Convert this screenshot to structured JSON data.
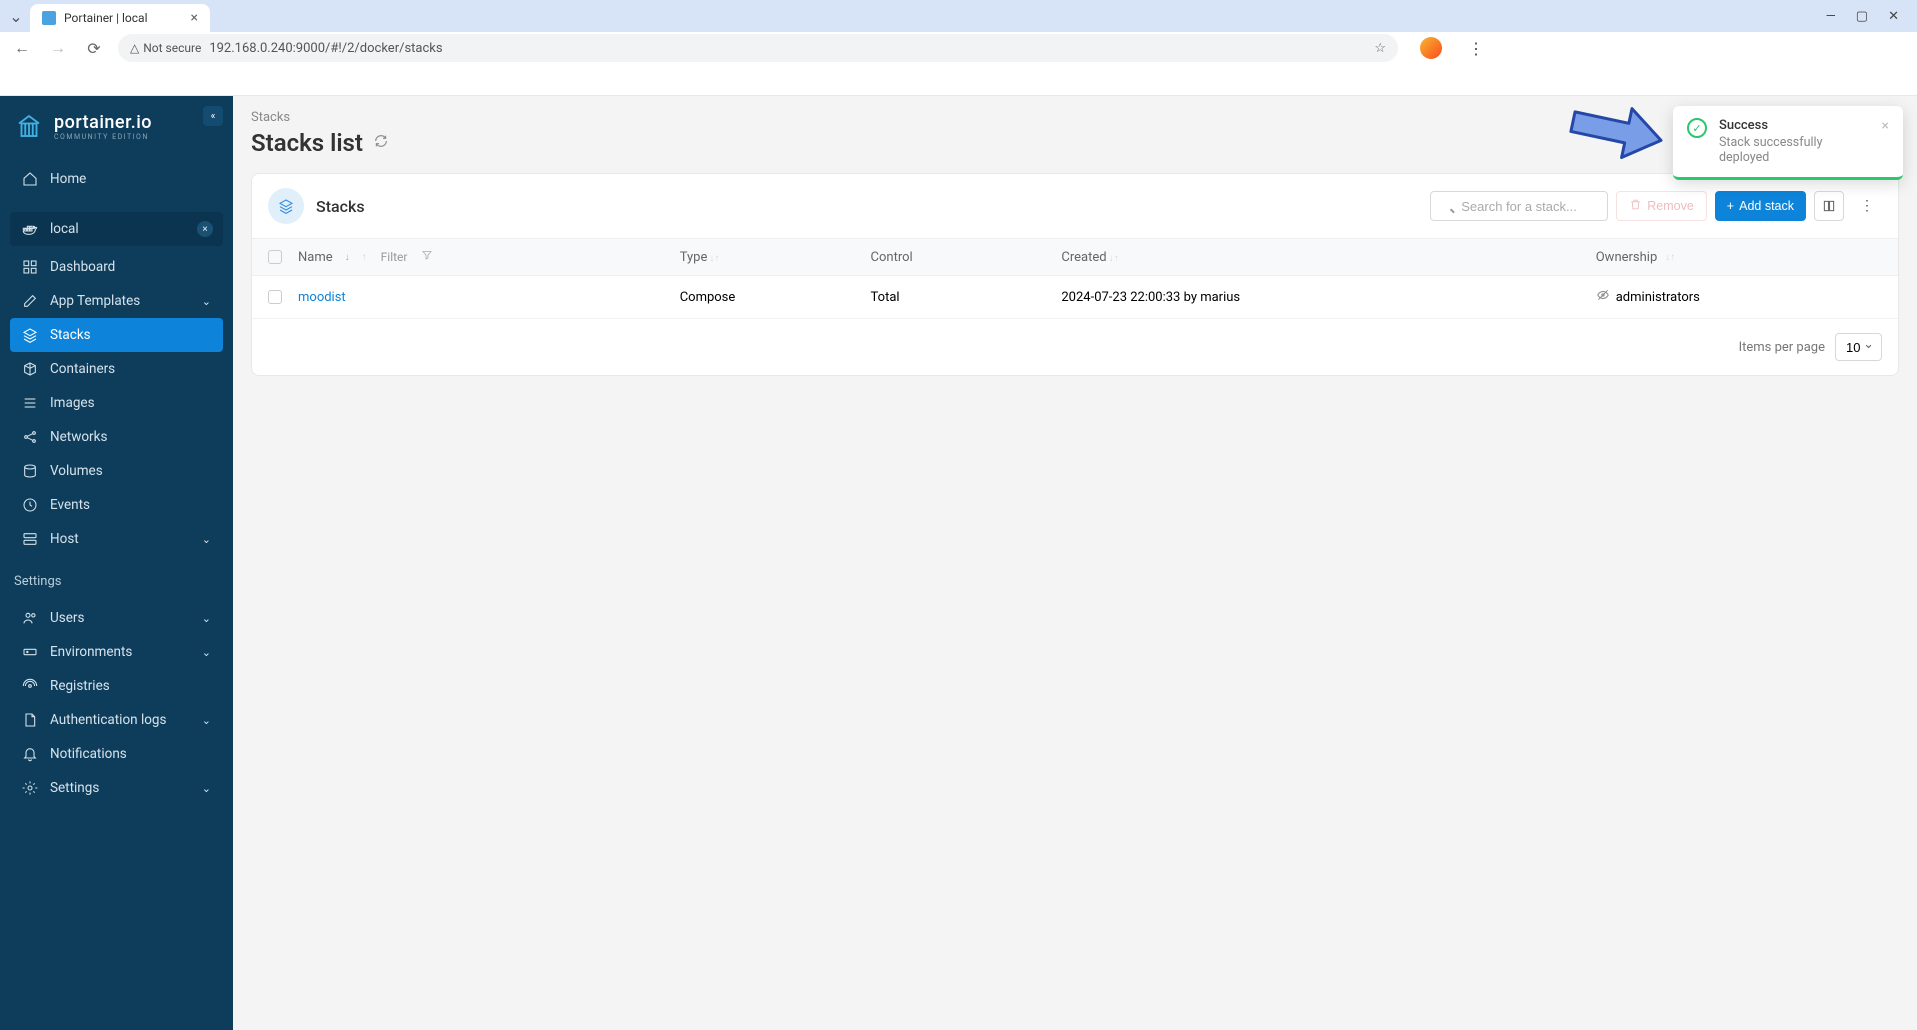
{
  "browser": {
    "tab_title": "Portainer | local",
    "url": "192.168.0.240:9000/#!/2/docker/stacks",
    "not_secure": "Not secure"
  },
  "sidebar": {
    "brand": "portainer.io",
    "brand_sub": "COMMUNITY EDITION",
    "home": "Home",
    "env_name": "local",
    "nav": [
      {
        "icon": "grid",
        "label": "Dashboard"
      },
      {
        "icon": "edit",
        "label": "App Templates",
        "chevron": true
      },
      {
        "icon": "layers",
        "label": "Stacks",
        "active": true
      },
      {
        "icon": "box",
        "label": "Containers"
      },
      {
        "icon": "list",
        "label": "Images"
      },
      {
        "icon": "share",
        "label": "Networks"
      },
      {
        "icon": "db",
        "label": "Volumes"
      },
      {
        "icon": "clock",
        "label": "Events"
      },
      {
        "icon": "server",
        "label": "Host",
        "chevron": true
      }
    ],
    "settings_header": "Settings",
    "settings": [
      {
        "icon": "users",
        "label": "Users",
        "chevron": true
      },
      {
        "icon": "hdd",
        "label": "Environments",
        "chevron": true
      },
      {
        "icon": "radio",
        "label": "Registries"
      },
      {
        "icon": "file",
        "label": "Authentication logs",
        "chevron": true
      },
      {
        "icon": "bell",
        "label": "Notifications"
      },
      {
        "icon": "gear",
        "label": "Settings",
        "chevron": true
      }
    ]
  },
  "page": {
    "breadcrumb": "Stacks",
    "title": "Stacks list"
  },
  "panel": {
    "title": "Stacks",
    "search_placeholder": "Search for a stack...",
    "remove_label": "Remove",
    "add_label": "Add stack"
  },
  "table": {
    "headers": {
      "name": "Name",
      "filter": "Filter",
      "type": "Type",
      "control": "Control",
      "created": "Created",
      "ownership": "Ownership"
    },
    "rows": [
      {
        "name": "moodist",
        "type": "Compose",
        "control": "Total",
        "created": "2024-07-23 22:00:33 by marius",
        "ownership": "administrators"
      }
    ],
    "items_per_page_label": "Items per page",
    "items_per_page_value": "10"
  },
  "toast": {
    "title": "Success",
    "message": "Stack successfully deployed"
  }
}
